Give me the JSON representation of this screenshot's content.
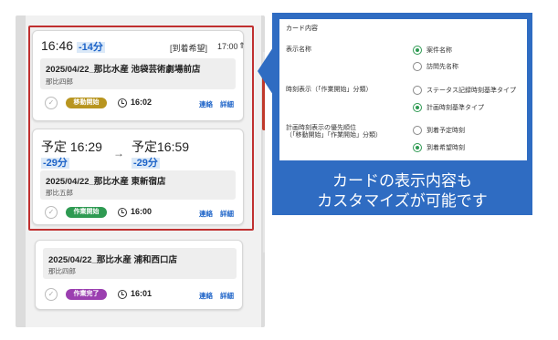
{
  "cards": [
    {
      "time": "16:46",
      "delta": "-14分",
      "request_label": "[到着希望]",
      "request_time": "17:00",
      "title": "2025/04/22_那比水産 池袋芸術劇場前店",
      "person": "那比四郎",
      "badge": "移動開始",
      "badge_color": "#b8951f",
      "clock": "16:02",
      "link1": "連絡",
      "link2": "詳細"
    },
    {
      "plan_label1": "予定",
      "plan_time1": "16:29",
      "plan_delta1": "-29分",
      "plan_label2": "予定",
      "plan_time2": "16:59",
      "plan_delta2": "-29分",
      "title": "2025/04/22_那比水産 東新宿店",
      "person": "那比五郎",
      "badge": "作業開始",
      "badge_color": "#2e9a52",
      "clock": "16:00",
      "link1": "連絡",
      "link2": "詳細"
    },
    {
      "title": "2025/04/22_那比水産 浦和西口店",
      "person": "那比四郎",
      "badge": "作業完了",
      "badge_color": "#9b3fb0",
      "clock": "16:01",
      "link1": "連絡",
      "link2": "詳細"
    }
  ],
  "settings": {
    "heading": "カード内容",
    "rows": [
      {
        "label": "表示名称",
        "options": [
          "案件名称",
          "訪問先名称"
        ],
        "selected": 0
      },
      {
        "label": "時刻表示（「作業開始」分類）",
        "options": [
          "ステータス記録時刻基準タイプ",
          "計画時刻基準タイプ"
        ],
        "selected": 1
      },
      {
        "label": "計画時刻表示の優先順位\n（「移動開始」「作業開始」分類）",
        "options": [
          "到着予定時刻",
          "到着希望時刻"
        ],
        "selected": 1
      }
    ]
  },
  "caption": {
    "line1": "カードの表示内容も",
    "line2": "カスタマイズが可能です"
  },
  "colors": {
    "accent_blue": "#2f6cc2",
    "highlight_red": "#c03030",
    "link_blue": "#1e64c8",
    "radio_green": "#2e9a52"
  }
}
